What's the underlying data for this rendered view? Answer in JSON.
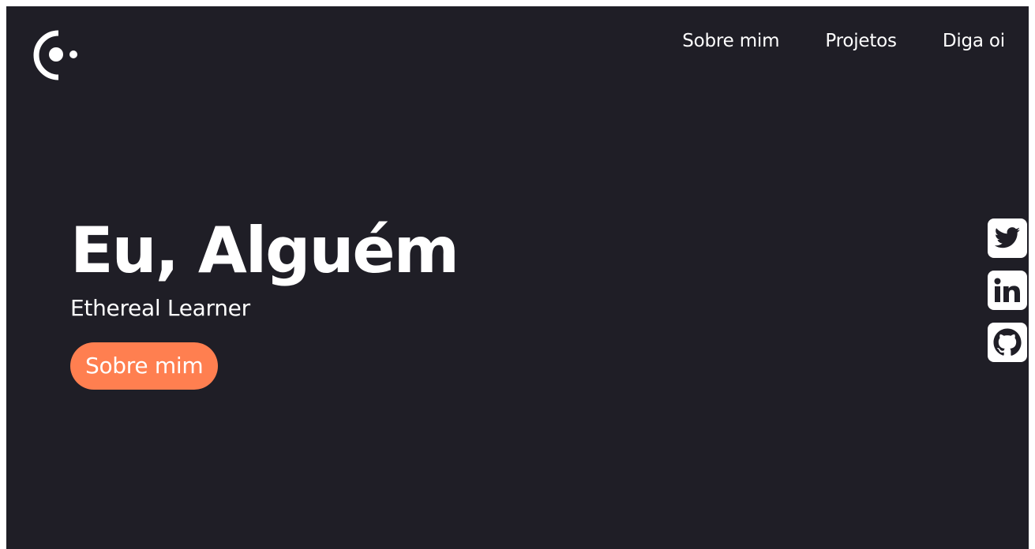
{
  "header": {
    "logo_icon": "logo-icon",
    "nav": [
      {
        "label": "Sobre mim"
      },
      {
        "label": "Projetos"
      },
      {
        "label": "Diga oi"
      }
    ]
  },
  "hero": {
    "title": "Eu, Alguém",
    "subtitle": "Ethereal Learner",
    "cta_label": "Sobre mim"
  },
  "social": [
    {
      "icon": "twitter-icon"
    },
    {
      "icon": "linkedin-icon"
    },
    {
      "icon": "github-icon"
    }
  ],
  "colors": {
    "background": "#1f1e26",
    "accent": "#ff7f50",
    "text": "#ffffff"
  }
}
